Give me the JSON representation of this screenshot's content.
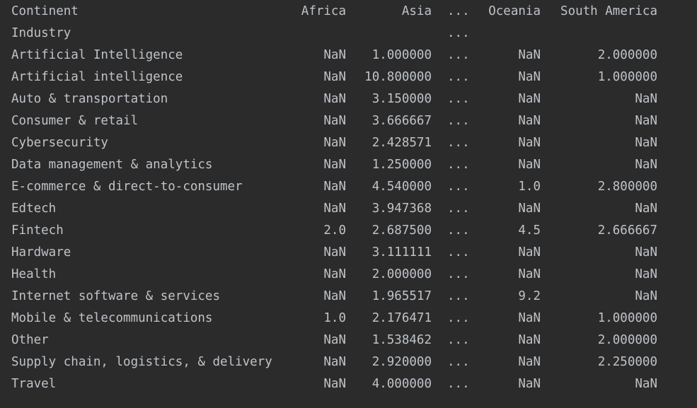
{
  "header": {
    "label": "Continent",
    "africa": "Africa",
    "asia": "Asia",
    "ellipsis": "...",
    "oceania": "Oceania",
    "south_america": "South America"
  },
  "index_row": {
    "label": "Industry",
    "ellipsis": "..."
  },
  "rows": [
    {
      "label": "Artificial Intelligence",
      "africa": "NaN",
      "asia": "1.000000",
      "ellipsis": "...",
      "oceania": "NaN",
      "south_america": "2.000000"
    },
    {
      "label": "Artificial intelligence",
      "africa": "NaN",
      "asia": "10.800000",
      "ellipsis": "...",
      "oceania": "NaN",
      "south_america": "1.000000"
    },
    {
      "label": "Auto & transportation",
      "africa": "NaN",
      "asia": "3.150000",
      "ellipsis": "...",
      "oceania": "NaN",
      "south_america": "NaN"
    },
    {
      "label": "Consumer & retail",
      "africa": "NaN",
      "asia": "3.666667",
      "ellipsis": "...",
      "oceania": "NaN",
      "south_america": "NaN"
    },
    {
      "label": "Cybersecurity",
      "africa": "NaN",
      "asia": "2.428571",
      "ellipsis": "...",
      "oceania": "NaN",
      "south_america": "NaN"
    },
    {
      "label": "Data management & analytics",
      "africa": "NaN",
      "asia": "1.250000",
      "ellipsis": "...",
      "oceania": "NaN",
      "south_america": "NaN"
    },
    {
      "label": "E-commerce & direct-to-consumer",
      "africa": "NaN",
      "asia": "4.540000",
      "ellipsis": "...",
      "oceania": "1.0",
      "south_america": "2.800000"
    },
    {
      "label": "Edtech",
      "africa": "NaN",
      "asia": "3.947368",
      "ellipsis": "...",
      "oceania": "NaN",
      "south_america": "NaN"
    },
    {
      "label": "Fintech",
      "africa": "2.0",
      "asia": "2.687500",
      "ellipsis": "...",
      "oceania": "4.5",
      "south_america": "2.666667"
    },
    {
      "label": "Hardware",
      "africa": "NaN",
      "asia": "3.111111",
      "ellipsis": "...",
      "oceania": "NaN",
      "south_america": "NaN"
    },
    {
      "label": "Health",
      "africa": "NaN",
      "asia": "2.000000",
      "ellipsis": "...",
      "oceania": "NaN",
      "south_america": "NaN"
    },
    {
      "label": "Internet software & services",
      "africa": "NaN",
      "asia": "1.965517",
      "ellipsis": "...",
      "oceania": "9.2",
      "south_america": "NaN"
    },
    {
      "label": "Mobile & telecommunications",
      "africa": "1.0",
      "asia": "2.176471",
      "ellipsis": "...",
      "oceania": "NaN",
      "south_america": "1.000000"
    },
    {
      "label": "Other",
      "africa": "NaN",
      "asia": "1.538462",
      "ellipsis": "...",
      "oceania": "NaN",
      "south_america": "2.000000"
    },
    {
      "label": "Supply chain, logistics, & delivery",
      "africa": "NaN",
      "asia": "2.920000",
      "ellipsis": "...",
      "oceania": "NaN",
      "south_america": "2.250000"
    },
    {
      "label": "Travel",
      "africa": "NaN",
      "asia": "4.000000",
      "ellipsis": "...",
      "oceania": "NaN",
      "south_america": "NaN"
    }
  ]
}
